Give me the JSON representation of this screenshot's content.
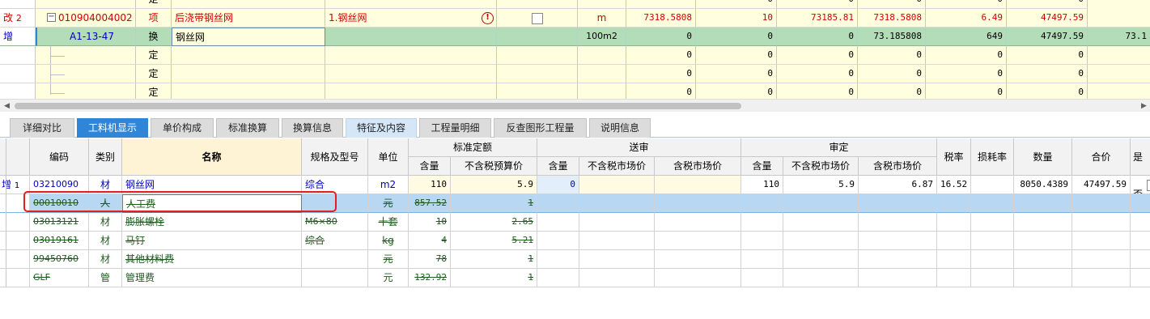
{
  "top_grid": {
    "partial_row": {
      "type": "定",
      "values": [
        "0",
        "0",
        "0",
        "0",
        "0"
      ]
    },
    "row_gai": {
      "status": "改",
      "index": "2",
      "code": "010904004002",
      "type": "项",
      "name": "后浇带钢丝网",
      "feature": "1.钢丝网",
      "unit": "m",
      "qty": "7318.5808",
      "v2": "10",
      "v3": "73185.81",
      "v4": "7318.5808",
      "v5": "6.49",
      "v6": "47497.59"
    },
    "row_zeng": {
      "status": "增",
      "code": "A1-13-47",
      "type": "换",
      "name": "钢丝网",
      "unit": "100m2",
      "qty": "0",
      "v2": "0",
      "v3": "0",
      "v4": "73.185808",
      "v5": "649",
      "v6": "47497.59",
      "v7": "73.1"
    },
    "ding_rows": [
      {
        "type": "定",
        "values": [
          "0",
          "0",
          "0",
          "0",
          "0",
          "0"
        ]
      },
      {
        "type": "定",
        "values": [
          "0",
          "0",
          "0",
          "0",
          "0",
          "0"
        ]
      },
      {
        "type": "定",
        "values": [
          "0",
          "0",
          "0",
          "0",
          "0",
          "0"
        ]
      }
    ]
  },
  "tabs": [
    {
      "label": "详细对比"
    },
    {
      "label": "工料机显示"
    },
    {
      "label": "单价构成"
    },
    {
      "label": "标准换算"
    },
    {
      "label": "换算信息"
    },
    {
      "label": "特征及内容"
    },
    {
      "label": "工程量明细"
    },
    {
      "label": "反查图形工程量"
    },
    {
      "label": "说明信息"
    }
  ],
  "bottom_grid": {
    "headers": {
      "code": "编码",
      "category": "类别",
      "name": "名称",
      "spec": "规格及型号",
      "unit": "单位",
      "standard_group": "标准定额",
      "submit_group": "送审",
      "approve_group": "审定",
      "content": "含量",
      "price_ex_budget": "不含税预算价",
      "price_ex_market": "不含税市场价",
      "price_in_market": "含税市场价",
      "tax_rate": "税率",
      "loss_rate": "损耗率",
      "quantity": "数量",
      "total": "合价",
      "is_temp": "是否"
    },
    "rows": [
      {
        "status": "增",
        "index": "1",
        "code": "03210090",
        "category": "材",
        "name": "钢丝网",
        "spec": "综合",
        "unit": "m2",
        "std_content": "110",
        "std_price": "5.9",
        "sub_content": "0",
        "sub_ex": "",
        "sub_in": "",
        "app_content": "110",
        "app_ex": "5.9",
        "app_in": "6.87",
        "tax": "16.52",
        "loss": "",
        "qty": "8050.4389",
        "total": "47497.59"
      },
      {
        "status": "",
        "index": "",
        "code": "00010010",
        "category": "人",
        "name": "人工费",
        "spec": "",
        "unit": "元",
        "std_content": "857.52",
        "std_price": "1"
      },
      {
        "status": "",
        "index": "",
        "code": "03013121",
        "category": "材",
        "name": "膨胀螺栓",
        "spec": "M6×80",
        "unit": "十套",
        "std_content": "10",
        "std_price": "2.65"
      },
      {
        "status": "",
        "index": "",
        "code": "03019161",
        "category": "材",
        "name": "马钉",
        "spec": "综合",
        "unit": "kg",
        "std_content": "4",
        "std_price": "5.21"
      },
      {
        "status": "",
        "index": "",
        "code": "99450760",
        "category": "材",
        "name": "其他材料费",
        "spec": "",
        "unit": "元",
        "std_content": "78",
        "std_price": "1"
      },
      {
        "status": "",
        "index": "",
        "code": "GLF",
        "category": "管",
        "name": "管理费",
        "spec": "",
        "unit": "元",
        "std_content": "132.92",
        "std_price": "1"
      }
    ]
  },
  "colors": {
    "accent": "#2f86d8",
    "yellow_row": "#ffffe0",
    "green_row": "#b3dcb8",
    "selection": "#b8d7f2",
    "highlight": "#e02020"
  }
}
